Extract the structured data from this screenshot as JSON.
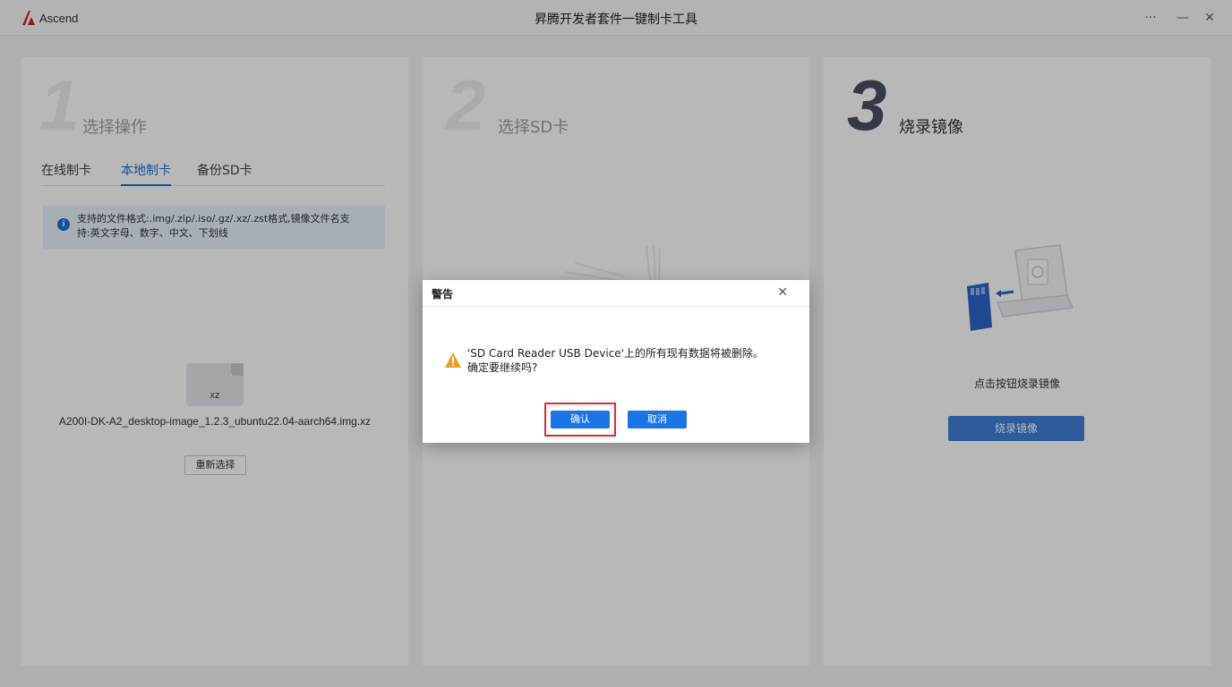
{
  "app": {
    "logo_text": "Ascend",
    "title": "昇腾开发者套件一键制卡工具",
    "controls": {
      "more": "···",
      "minimize": "—",
      "close": "✕"
    }
  },
  "step1": {
    "number": "1",
    "title": "选择操作",
    "tabs": [
      {
        "label": "在线制卡",
        "active": false
      },
      {
        "label": "本地制卡",
        "active": true
      },
      {
        "label": "备份SD卡",
        "active": false
      }
    ],
    "info_line1": "支持的文件格式:.img/.zip/.iso/.gz/.xz/.zst格式,镜像文件名支",
    "info_line2": "持:英文字母、数字、中文、下划线",
    "file_ext": "xz",
    "file_name": "A200I-DK-A2_desktop-image_1.2.3_ubuntu22.04-aarch64.img.xz",
    "reselect_label": "重新选择"
  },
  "step2": {
    "number": "2",
    "title": "选择SD卡"
  },
  "step3": {
    "number": "3",
    "title": "烧录镜像",
    "caption": "点击按钮烧录镜像",
    "burn_label": "烧录镜像"
  },
  "dialog": {
    "title": "警告",
    "message_line1": "'SD Card Reader USB Device'上的所有现有数据将被删除。",
    "message_line2": "确定要继续吗?",
    "confirm_label": "确认",
    "cancel_label": "取消"
  },
  "colors": {
    "accent": "#1a73e8",
    "highlight": "#e0292f",
    "brand_red": "#d7261e"
  }
}
